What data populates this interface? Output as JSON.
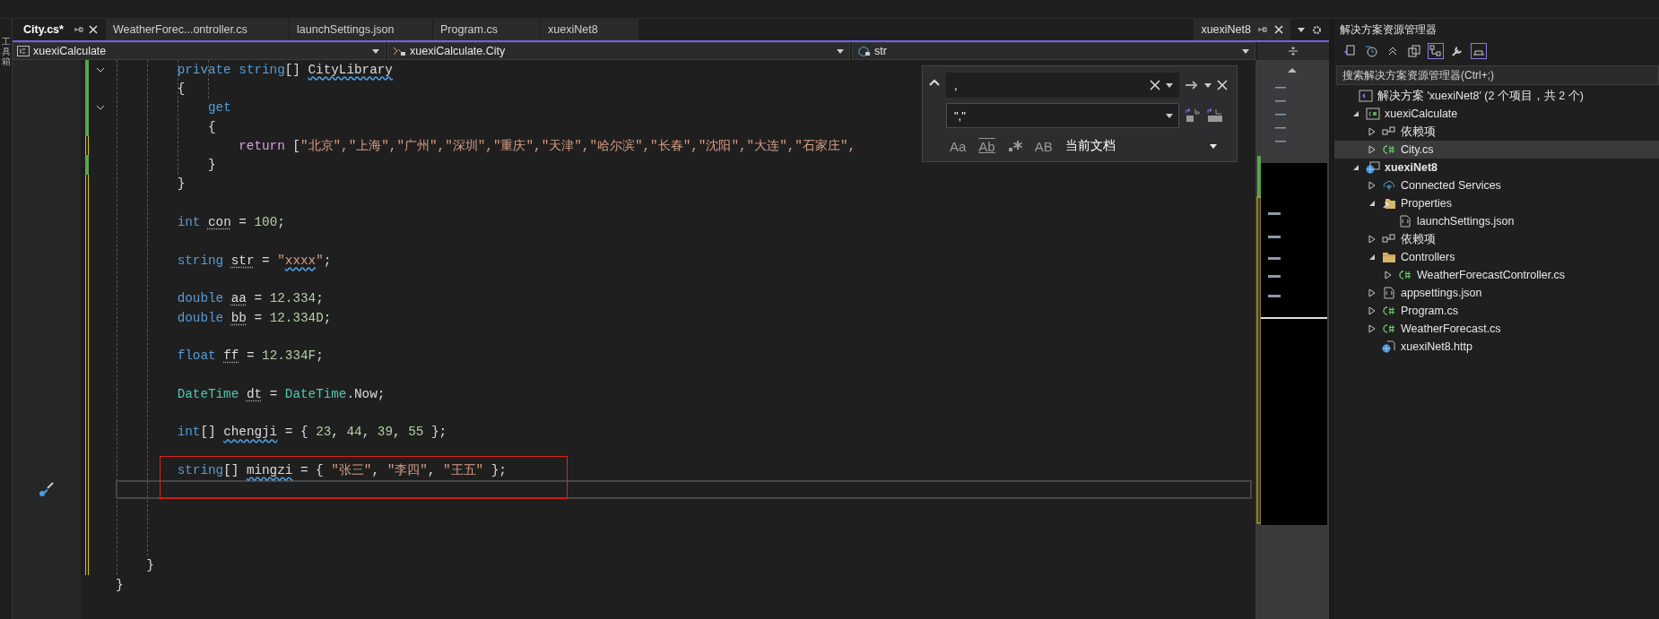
{
  "side_strip": {
    "label": "工具箱"
  },
  "tabs": [
    {
      "label": "City.cs*",
      "selected": true
    },
    {
      "label": "WeatherForec...ontroller.cs",
      "selected": false
    },
    {
      "label": "launchSettings.json",
      "selected": false
    },
    {
      "label": "Program.cs",
      "selected": false
    },
    {
      "label": "xuexiNet8",
      "selected": false
    }
  ],
  "tool_tab": {
    "label": "xuexiNet8"
  },
  "nav_bar": {
    "project": "xuexiCalculate",
    "type": "xuexiCalculate.City",
    "member": "str"
  },
  "code": {
    "blocks": [
      {
        "kind": "plain",
        "lines": [
          {
            "kind": "code",
            "saved": true,
            "fold_open": true,
            "tokens": [
              {
                "kind": "keyword",
                "text": "        private"
              },
              {
                "kind": "keyword",
                "text": " string"
              },
              {
                "kind": "plain",
                "text": "[] "
              },
              {
                "kind": "ident-squiggle",
                "text": "CityLibrary"
              }
            ]
          },
          {
            "kind": "code",
            "saved": true,
            "tokens": [
              {
                "kind": "plain",
                "text": "        {"
              }
            ]
          },
          {
            "kind": "code",
            "saved": true,
            "fold_open": true,
            "tokens": [
              {
                "kind": "keyword",
                "text": "            get"
              }
            ]
          },
          {
            "kind": "code",
            "saved": true,
            "tokens": [
              {
                "kind": "plain",
                "text": "            {"
              }
            ]
          },
          {
            "kind": "code",
            "saved": false,
            "tokens": [
              {
                "kind": "control",
                "text": "                return"
              },
              {
                "kind": "plain",
                "text": " ["
              },
              {
                "kind": "string",
                "text": "\"北京\",\"上海\",\"广州\",\"深圳\",\"重庆\",\"天津\",\"哈尔滨\",\"长春\",\"沈阳\",\"大连\",\"石家庄\","
              }
            ]
          },
          {
            "kind": "code",
            "saved": true,
            "tokens": [
              {
                "kind": "plain",
                "text": "            }"
              }
            ]
          },
          {
            "kind": "code",
            "saved": false,
            "tokens": [
              {
                "kind": "plain",
                "text": "        }"
              }
            ]
          },
          {
            "kind": "blank",
            "saved": false
          },
          {
            "kind": "code",
            "saved": false,
            "tokens": [
              {
                "kind": "keyword",
                "text": "        int"
              },
              {
                "kind": "ident-dotted",
                "text": " con"
              },
              {
                "kind": "plain",
                "text": " = "
              },
              {
                "kind": "number",
                "text": "100"
              },
              {
                "kind": "plain",
                "text": ";"
              }
            ]
          },
          {
            "kind": "blank",
            "saved": false
          },
          {
            "kind": "code",
            "saved": false,
            "tokens": [
              {
                "kind": "keyword",
                "text": "        string"
              },
              {
                "kind": "ident-dotted",
                "text": " str"
              },
              {
                "kind": "plain",
                "text": " = "
              },
              {
                "kind": "string",
                "text": "\""
              },
              {
                "kind": "string-squiggle",
                "text": "xxxx"
              },
              {
                "kind": "string",
                "text": "\""
              },
              {
                "kind": "plain",
                "text": ";"
              }
            ]
          },
          {
            "kind": "blank",
            "saved": false
          },
          {
            "kind": "code",
            "saved": false,
            "tokens": [
              {
                "kind": "keyword",
                "text": "        double"
              },
              {
                "kind": "ident-dotted",
                "text": " aa"
              },
              {
                "kind": "plain",
                "text": " = "
              },
              {
                "kind": "number",
                "text": "12.334"
              },
              {
                "kind": "plain",
                "text": ";"
              }
            ]
          },
          {
            "kind": "code",
            "saved": false,
            "tokens": [
              {
                "kind": "keyword",
                "text": "        double"
              },
              {
                "kind": "ident-dotted",
                "text": " bb"
              },
              {
                "kind": "plain",
                "text": " = "
              },
              {
                "kind": "number",
                "text": "12.334D"
              },
              {
                "kind": "plain",
                "text": ";"
              }
            ]
          },
          {
            "kind": "blank",
            "saved": false
          },
          {
            "kind": "code",
            "saved": false,
            "tokens": [
              {
                "kind": "keyword",
                "text": "        float"
              },
              {
                "kind": "ident-dotted",
                "text": " ff"
              },
              {
                "kind": "plain",
                "text": " = "
              },
              {
                "kind": "number",
                "text": "12.334F"
              },
              {
                "kind": "plain",
                "text": ";"
              }
            ]
          },
          {
            "kind": "blank",
            "saved": false
          },
          {
            "kind": "code",
            "saved": false,
            "tokens": [
              {
                "kind": "type",
                "text": "        DateTime"
              },
              {
                "kind": "ident-dotted",
                "text": " dt"
              },
              {
                "kind": "plain",
                "text": " = "
              },
              {
                "kind": "type",
                "text": "DateTime"
              },
              {
                "kind": "plain",
                "text": ".Now;"
              }
            ]
          },
          {
            "kind": "blank",
            "saved": false
          },
          {
            "kind": "code",
            "saved": false,
            "tokens": [
              {
                "kind": "keyword",
                "text": "        int"
              },
              {
                "kind": "plain",
                "text": "[] "
              },
              {
                "kind": "ident-squiggle",
                "text": "chengji"
              },
              {
                "kind": "plain",
                "text": " = { "
              },
              {
                "kind": "number",
                "text": "23"
              },
              {
                "kind": "plain",
                "text": ", "
              },
              {
                "kind": "number",
                "text": "44"
              },
              {
                "kind": "plain",
                "text": ", "
              },
              {
                "kind": "number",
                "text": "39"
              },
              {
                "kind": "plain",
                "text": ", "
              },
              {
                "kind": "number",
                "text": "55"
              },
              {
                "kind": "plain",
                "text": " };"
              }
            ]
          },
          {
            "kind": "blank",
            "saved": false
          }
        ]
      },
      {
        "kind": "boxed",
        "lines": [
          {
            "kind": "code",
            "saved": false,
            "tokens": [
              {
                "kind": "keyword",
                "text": "        string"
              },
              {
                "kind": "plain",
                "text": "[] "
              },
              {
                "kind": "ident-squiggle",
                "text": "mingzi"
              },
              {
                "kind": "plain",
                "text": " = { "
              },
              {
                "kind": "string",
                "text": "\"张三\""
              },
              {
                "kind": "plain",
                "text": ", "
              },
              {
                "kind": "string",
                "text": "\"李四\""
              },
              {
                "kind": "plain",
                "text": ", "
              },
              {
                "kind": "string",
                "text": "\"王五\""
              },
              {
                "kind": "plain",
                "text": " };"
              }
            ]
          },
          {
            "kind": "current",
            "saved": false
          }
        ]
      },
      {
        "kind": "plain",
        "lines": [
          {
            "kind": "blank",
            "saved": false
          },
          {
            "kind": "blank",
            "saved": false
          },
          {
            "kind": "blank",
            "saved": false
          },
          {
            "kind": "code",
            "saved": false,
            "tokens": [
              {
                "kind": "plain",
                "text": "    }"
              }
            ]
          },
          {
            "kind": "code",
            "tokens": [
              {
                "kind": "plain",
                "text": "}"
              }
            ]
          }
        ]
      }
    ]
  },
  "find_panel": {
    "search_value": ",",
    "replace_value": "\",\"",
    "scope": "当前文档",
    "options": [
      "Aa",
      "Ab",
      "AB"
    ]
  },
  "solution_explorer": {
    "title": "解决方案资源管理器",
    "search_placeholder": "搜索解决方案资源管理器(Ctrl+;)",
    "tree": [
      {
        "kind": "solution",
        "label": "解决方案 'xuexiNet8' (2 个项目，共 2 个)",
        "selected": false,
        "children": [
          {
            "kind": "csproj",
            "label": "xuexiCalculate",
            "expanded": true,
            "selected": false,
            "children": [
              {
                "kind": "dependencies",
                "label": "依赖项",
                "expanded": false,
                "selected": false
              },
              {
                "kind": "csharp",
                "label": "City.cs",
                "expanded": false,
                "selected": true
              }
            ]
          },
          {
            "kind": "webproj",
            "label": "xuexiNet8",
            "bold": true,
            "expanded": true,
            "selected": false,
            "children": [
              {
                "kind": "services",
                "label": "Connected Services",
                "expanded": false,
                "selected": false
              },
              {
                "kind": "properties",
                "label": "Properties",
                "expanded": true,
                "selected": false,
                "children": [
                  {
                    "kind": "json",
                    "label": "launchSettings.json",
                    "selected": false
                  }
                ]
              },
              {
                "kind": "dependencies",
                "label": "依赖项",
                "expanded": false,
                "selected": false
              },
              {
                "kind": "folder",
                "label": "Controllers",
                "expanded": true,
                "selected": false,
                "children": [
                  {
                    "kind": "csharp",
                    "label": "WeatherForecastController.cs",
                    "expanded": false,
                    "selected": false
                  }
                ]
              },
              {
                "kind": "json",
                "label": "appsettings.json",
                "expanded": false,
                "selected": false
              },
              {
                "kind": "csharp",
                "label": "Program.cs",
                "expanded": false,
                "selected": false
              },
              {
                "kind": "csharp",
                "label": "WeatherForecast.cs",
                "expanded": false,
                "selected": false
              },
              {
                "kind": "http",
                "label": "xuexiNet8.http",
                "selected": false
              }
            ]
          }
        ]
      }
    ]
  }
}
